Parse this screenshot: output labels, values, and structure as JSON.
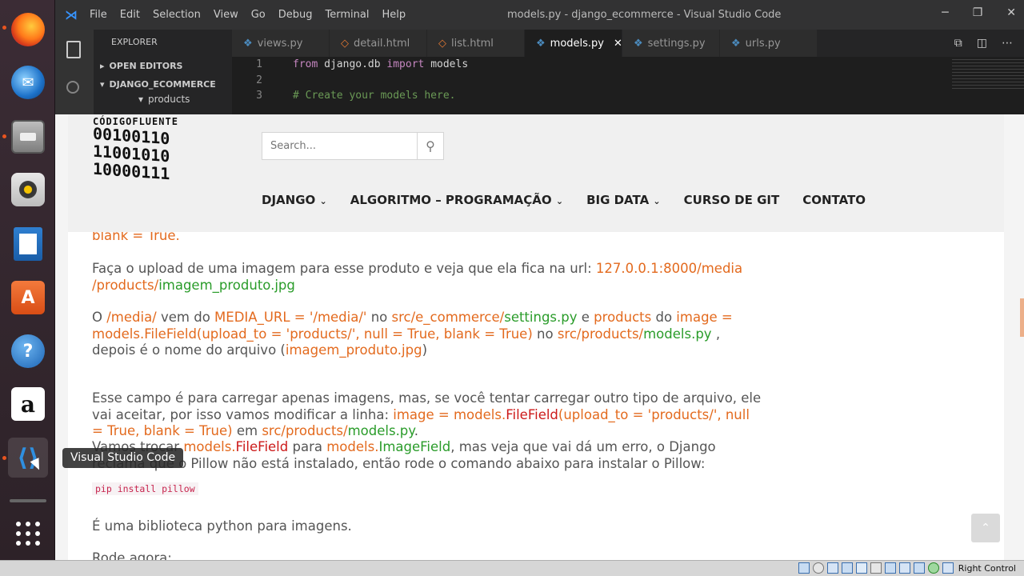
{
  "dock": {
    "items": [
      {
        "name": "firefox",
        "label": "Firefox"
      },
      {
        "name": "thunderbird",
        "label": "Thunderbird"
      },
      {
        "name": "files",
        "label": "Files"
      },
      {
        "name": "rhythmbox",
        "label": "Rhythmbox"
      },
      {
        "name": "writer",
        "label": "Writer"
      },
      {
        "name": "software",
        "label": "A"
      },
      {
        "name": "help",
        "label": "?"
      },
      {
        "name": "amazon",
        "label": "a"
      },
      {
        "name": "vscode",
        "label": "VS"
      }
    ],
    "tooltip": "Visual Studio Code"
  },
  "vscode": {
    "menu": [
      "File",
      "Edit",
      "Selection",
      "View",
      "Go",
      "Debug",
      "Terminal",
      "Help"
    ],
    "title": "models.py - django_ecommerce - Visual Studio Code",
    "explorer": {
      "header": "EXPLORER",
      "open_editors": "OPEN EDITORS",
      "project": "DJANGO_ECOMMERCE",
      "folder": "products"
    },
    "tabs": [
      {
        "label": "views.py",
        "icon": "python-icon"
      },
      {
        "label": "detail.html",
        "icon": "html-icon"
      },
      {
        "label": "list.html",
        "icon": "html-icon"
      },
      {
        "label": "models.py",
        "icon": "python-icon",
        "active": true
      },
      {
        "label": "settings.py",
        "icon": "python-icon"
      },
      {
        "label": "urls.py",
        "icon": "python-icon"
      }
    ],
    "code": [
      {
        "n": "1",
        "kw1": "from",
        "mid": " django.db ",
        "kw2": "import",
        "rest": " models"
      },
      {
        "n": "2",
        "kw1": "",
        "mid": "",
        "kw2": "",
        "rest": ""
      },
      {
        "n": "3",
        "comment": "# Create your models here."
      }
    ]
  },
  "site": {
    "logo_title": "CÓDIGOFLUENTE",
    "logo_lines": [
      "00100110",
      "11001010",
      "10000111"
    ],
    "search_placeholder": "Search...",
    "nav": [
      "DJANGO",
      "ALGORITMO – PROGRAMAÇÃO",
      "BIG DATA",
      "CURSO DE GIT",
      "CONTATO"
    ],
    "content": {
      "p0": "blank = True.",
      "p1a": "Faça o upload de uma imagem para esse produto e veja que ela fica na url: ",
      "p1b": "127.0.0.1:8000/media /products/",
      "p1c": "imagem_produto.jpg",
      "p2a": "O ",
      "p2b": "/media/",
      "p2c": " vem do ",
      "p2d": "MEDIA_URL = '/media/'",
      "p2e": " no ",
      "p2f": "src/e_commerce/",
      "p2g": "settings.py",
      "p2h": " e ",
      "p2i": "products",
      "p2j": " do ",
      "p2k": "image = models.FileField(upload_to = 'products/', null = True, blank = True)",
      "p2l": " no ",
      "p2m": "src/products/",
      "p2n": "models.py",
      "p2o": " , depois é o nome do arquivo (",
      "p2p": "imagem_produto.jpg",
      "p2q": ")",
      "p3a": "Esse campo é para carregar apenas imagens, mas, se você tentar carregar outro tipo de arquivo, ele vai aceitar, por isso vamos modificar a linha: ",
      "p3b": "image = models.",
      "p3c": "FileField",
      "p3d": "(upload_to = 'products/', null = True, blank = True)",
      "p3e": " em ",
      "p3f": "src/products/",
      "p3g": "models.py",
      "p3h": ".",
      "p4a": "Vamos trocar ",
      "p4b": "models.",
      "p4c": "FileField",
      "p4d": " para ",
      "p4e": "models.",
      "p4f": "ImageField",
      "p4g": ", mas veja que vai dá um erro, o Django reclama que o Pillow não está instalado, então rode o comando abaixo para instalar o Pillow:",
      "code": "pip install pillow",
      "p5": "É uma biblioteca python para imagens.",
      "p6": "Rode agora:"
    }
  },
  "statusbar": {
    "right_control": "Right Control"
  }
}
